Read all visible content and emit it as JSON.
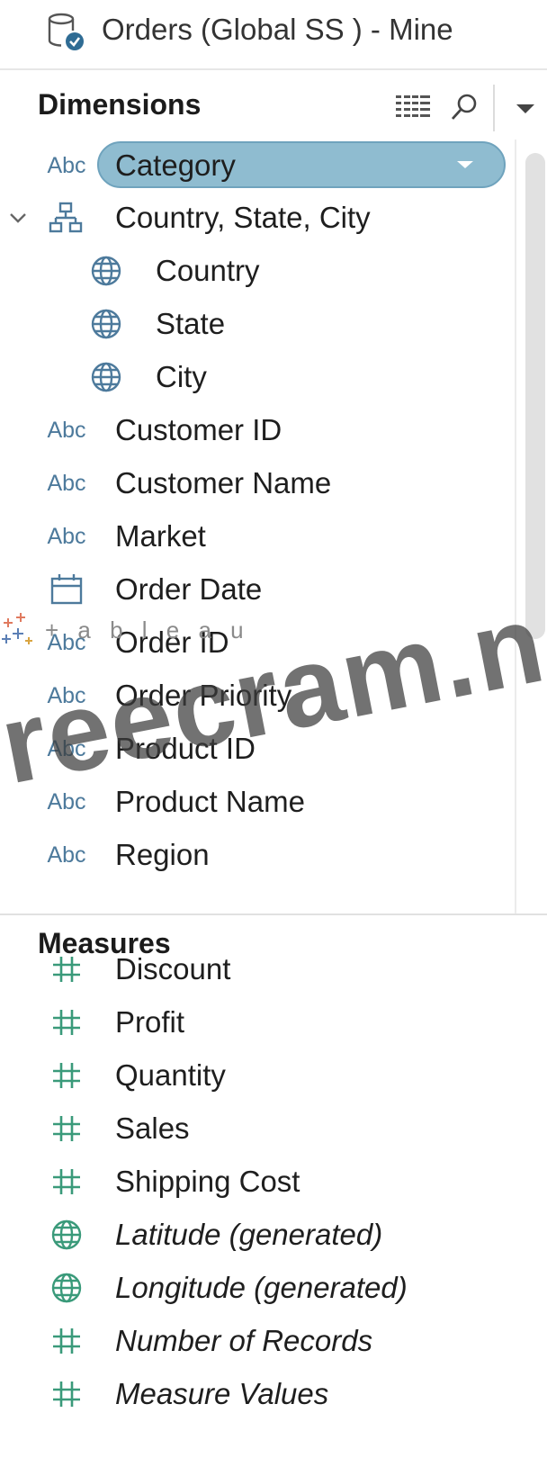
{
  "datasource": {
    "name": "Orders (Global SS ) - Mine",
    "icon": "database-check-icon"
  },
  "dimensions": {
    "title": "Dimensions",
    "icons": [
      "list-view-icon",
      "search-icon",
      "menu-caret-icon"
    ],
    "fields": [
      {
        "label": "Category",
        "type": "Abc",
        "selected": true
      },
      {
        "label": "Country, State, City",
        "type": "hierarchy-icon",
        "expanded": true
      },
      {
        "label": "Country",
        "type": "globe-icon"
      },
      {
        "label": "State",
        "type": "globe-icon"
      },
      {
        "label": "City",
        "type": "globe-icon"
      },
      {
        "label": "Customer ID",
        "type": "Abc"
      },
      {
        "label": "Customer Name",
        "type": "Abc"
      },
      {
        "label": "Market",
        "type": "Abc"
      },
      {
        "label": "Order Date",
        "type": "calendar-icon"
      },
      {
        "label": "Order ID",
        "type": "Abc"
      },
      {
        "label": "Order Priority",
        "type": "Abc"
      },
      {
        "label": "Product ID",
        "type": "Abc"
      },
      {
        "label": "Product Name",
        "type": "Abc"
      },
      {
        "label": "Region",
        "type": "Abc"
      }
    ]
  },
  "measures": {
    "title": "Measures",
    "fields": [
      {
        "label": "Discount",
        "type": "hash-icon"
      },
      {
        "label": "Profit",
        "type": "hash-icon"
      },
      {
        "label": "Quantity",
        "type": "hash-icon"
      },
      {
        "label": "Sales",
        "type": "hash-icon"
      },
      {
        "label": "Shipping Cost",
        "type": "hash-icon"
      },
      {
        "label": "Latitude (generated)",
        "type": "globe-icon",
        "italic": true
      },
      {
        "label": "Longitude (generated)",
        "type": "globe-icon",
        "italic": true
      },
      {
        "label": "Number of Records",
        "type": "hash-icon",
        "italic": true
      },
      {
        "label": "Measure Values",
        "type": "hash-icon",
        "italic": true
      }
    ]
  },
  "overlay": {
    "watermark": "reecram.ne",
    "tableau_logo_text": "+ a b l e a u"
  },
  "colors": {
    "dimension_blue": "#4d7a9c",
    "measure_green": "#3a9a7a",
    "selected_pill": "#8fbcd0"
  }
}
